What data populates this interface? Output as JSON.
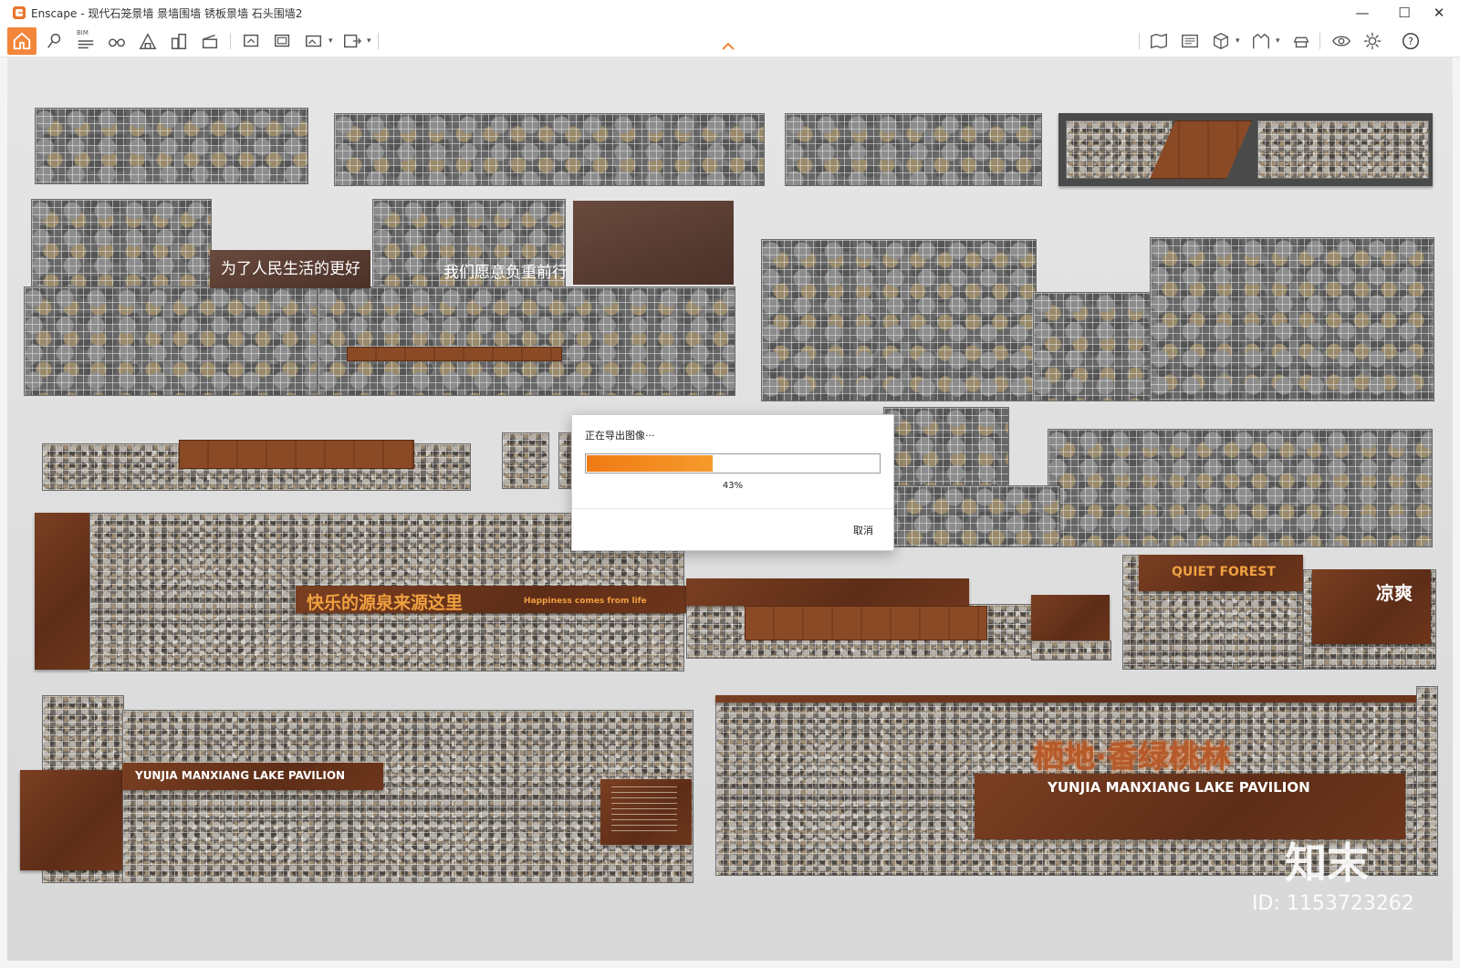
{
  "window": {
    "title": "Enscape - 现代石笼景墙 景墙围墙 锈板景墙 石头围墙2",
    "controls": {
      "minimize": "—",
      "maximize": "☐",
      "close": "✕"
    }
  },
  "toolbar": {
    "bim_label": "BIM",
    "icons_left": [
      "home-icon",
      "pin-icon",
      "bim-icon",
      "binoculars-icon",
      "warehouse-icon",
      "buildings-icon",
      "clapboard-icon",
      "screenshot-icon",
      "batch-render-icon",
      "panorama-icon",
      "export-icon"
    ],
    "icons_right": [
      "map-icon",
      "panel-icon",
      "cube-icon",
      "archway-icon",
      "hat-icon",
      "eye-icon",
      "gear-icon",
      "help-icon"
    ]
  },
  "scene": {
    "sign_1": "为了人民生活的更好",
    "sign_2": "我们愿意负重前行",
    "sign_3_zh": "快乐的源泉来源这里",
    "sign_3_en": "Happiness comes from life",
    "sign_4_en": "QUIET FOREST",
    "sign_4_zh": "凉爽",
    "sign_5_en": "YUNJIA MANXIANG LAKE PAVILION",
    "sign_6_zh": "栖地·香绿桃林",
    "sign_6_en": "YUNJIA MANXIANG LAKE PAVILION",
    "watermark_brand": "知末",
    "watermark_id": "ID: 1153723262"
  },
  "export_dialog": {
    "title": "正在导出图像···",
    "progress": 0.43,
    "progress_label": "43%",
    "cancel_label": "取消"
  },
  "colors": {
    "accent": "#f2863a",
    "progress": "#f07a14",
    "rust": "#6d361c"
  }
}
